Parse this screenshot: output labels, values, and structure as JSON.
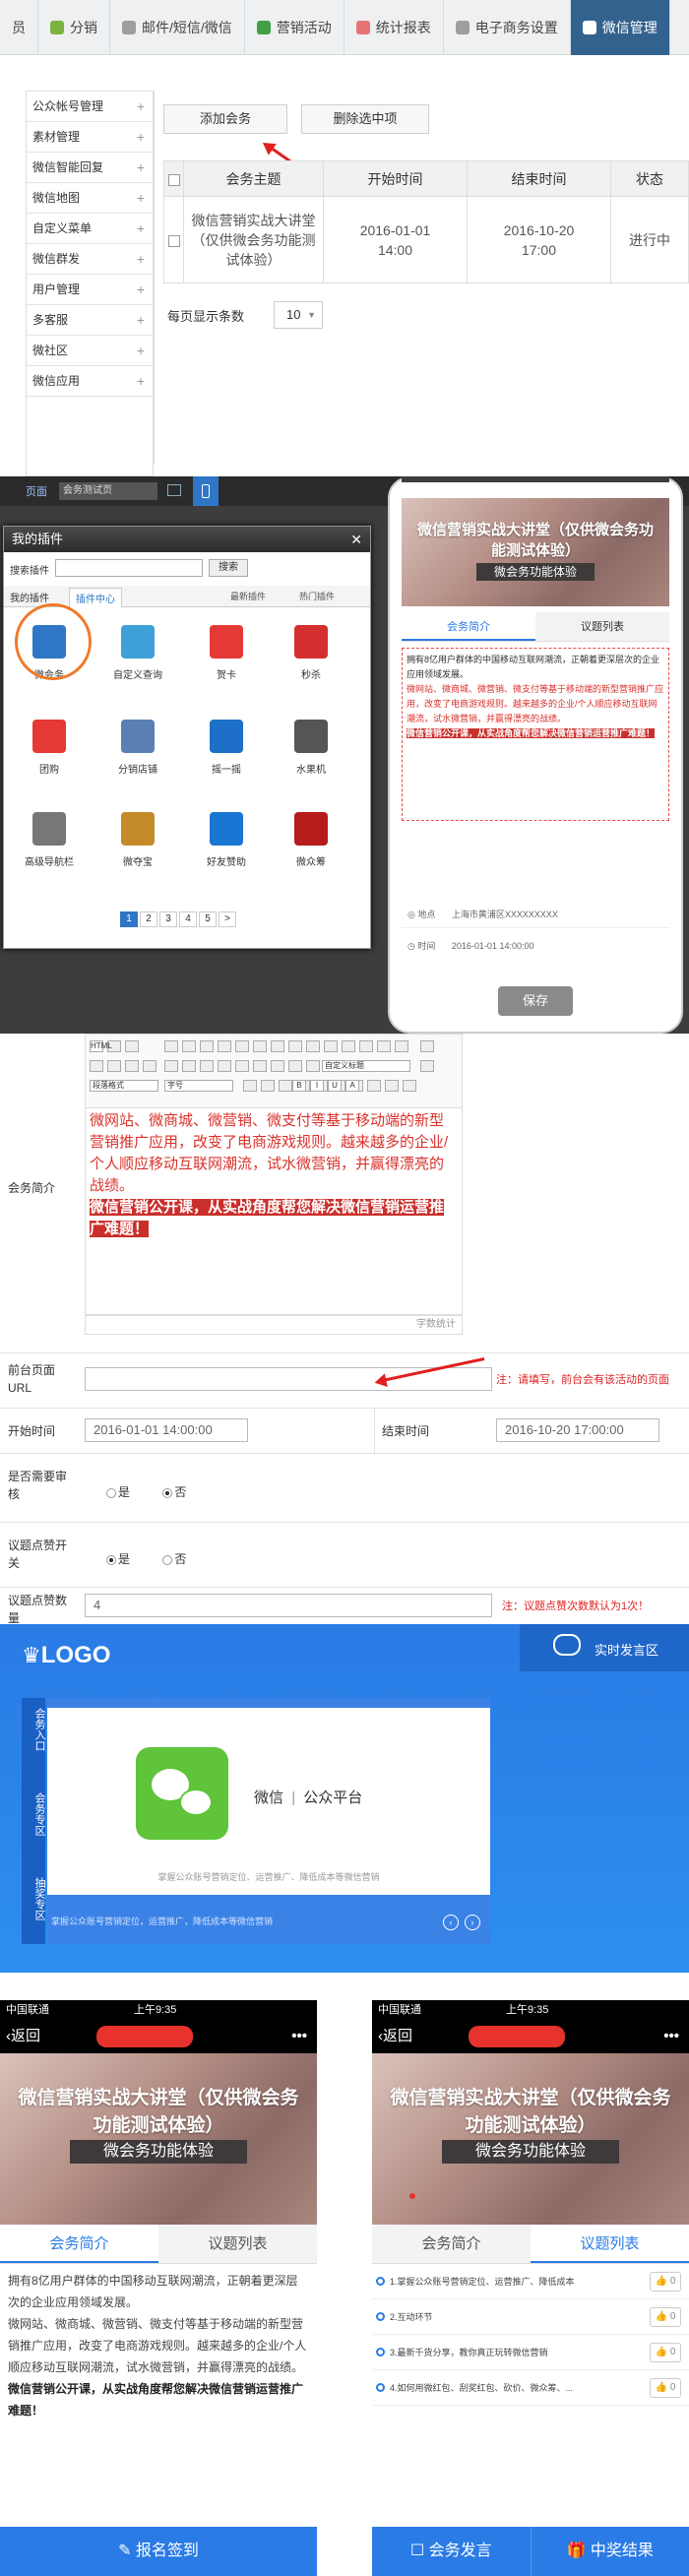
{
  "topnav": {
    "tabs": [
      {
        "label": "员",
        "icon": "",
        "color": "#8a8a8a"
      },
      {
        "label": "分销",
        "icon": "share-icon",
        "color": "#7cb342"
      },
      {
        "label": "邮件/短信/微信",
        "icon": "mail-icon",
        "color": "#9e9e9e"
      },
      {
        "label": "营销活动",
        "icon": "campaign-icon",
        "color": "#43a047"
      },
      {
        "label": "统计报表",
        "icon": "chart-icon",
        "color": "#e57373"
      },
      {
        "label": "电子商务设置",
        "icon": "shop-icon",
        "color": "#9e9e9e"
      },
      {
        "label": "微信管理",
        "icon": "wechat-icon",
        "color": "#ffffff"
      }
    ]
  },
  "sidemenu": {
    "items": [
      "公众帐号管理",
      "素材管理",
      "微信智能回复",
      "微信地图",
      "自定义菜单",
      "微信群发",
      "用户管理",
      "多客服",
      "微社区",
      "微信应用"
    ]
  },
  "toolbar": {
    "add": "添加会务",
    "delete": "删除选中项"
  },
  "table": {
    "headers": [
      "会务主题",
      "开始时间",
      "结束时间",
      "状态"
    ],
    "row": {
      "title": "微信营销实战大讲堂（仅供微会务功能测试体验）",
      "start": "2016-01-01 14:00",
      "end": "2016-10-20 17:00",
      "status": "进行中"
    }
  },
  "paging": {
    "label": "每页显示条数",
    "value": "10"
  },
  "editor": {
    "topbar": {
      "page": "页面",
      "select": "会务测试页"
    },
    "plugin": {
      "title": "我的插件",
      "search_label": "搜索插件",
      "search_btn": "搜索",
      "tab_mine": "我的插件",
      "tab_center": "插件中心",
      "newest": "最新插件",
      "hot": "热门插件",
      "items": [
        {
          "name": "微会务",
          "color": "#2f76c6"
        },
        {
          "name": "自定义查询",
          "color": "#3ea0d6"
        },
        {
          "name": "贺卡",
          "color": "#e53935"
        },
        {
          "name": "秒杀",
          "color": "#d32f2f"
        },
        {
          "name": "团购",
          "color": "#e53935"
        },
        {
          "name": "分销店铺",
          "color": "#5b7fb2"
        },
        {
          "name": "摇一摇",
          "color": "#1e6fc7"
        },
        {
          "name": "水果机",
          "color": "#555555"
        },
        {
          "name": "高级导航栏",
          "color": "#777777"
        },
        {
          "name": "微夺宝",
          "color": "#c58a2a"
        },
        {
          "name": "好友赞助",
          "color": "#1976d2"
        },
        {
          "name": "微众筹",
          "color": "#b71c1c"
        }
      ],
      "pages": [
        "1",
        "2",
        "3",
        "4",
        "5",
        ">"
      ]
    },
    "phone": {
      "hero_title": "微信营销实战大讲堂（仅供微会务功能测试体验）",
      "hero_sub": "微会务功能体验",
      "tab_intro": "会务简介",
      "tab_topics": "议题列表",
      "intro_black": "拥有8亿用户群体的中国移动互联网潮流，正朝着更深层次的企业应用领域发展。",
      "intro_red": "微网站、微商城、微营销、微支付等基于移动端的新型营销推广应用，改变了电商游戏规则。越来越多的企业/个人顺应移动互联网潮流，试水微营销，并赢得漂亮的战绩。",
      "intro_hl": "微信营销公开课，从实战角度帮您解决微信营销运营推广难题！",
      "loc_label": "地点",
      "loc_val": "上海市黄浦区XXXXXXXXX",
      "time_label": "时间",
      "time_val": "2016-01-01 14:00:00",
      "save": "保存"
    }
  },
  "form": {
    "intro_label": "会务简介",
    "toolbar_items": [
      "HTML",
      "B",
      "I",
      "U",
      "A",
      "x²",
      "x₂",
      "自定义标题",
      "段落格式",
      "字号"
    ],
    "intro_red": "微网站、微商城、微营销、微支付等基于移动端的新型营销推广应用，改变了电商游戏规则。越来越多的企业/个人顺应移动互联网潮流，试水微营销，并赢得漂亮的战绩。",
    "intro_hl": "微信营销公开课，从实战角度帮您解决微信营销运营推广难题！",
    "word_count": "字数统计",
    "url_label": "前台页面URL",
    "url_note": "注：请填写，前台会有该活动的页面",
    "start_label": "开始时间",
    "start_val": "2016-01-01 14:00:00",
    "end_label": "结束时间",
    "end_val": "2016-10-20 17:00:00",
    "review_label": "是否需要审核",
    "review_yes": "是",
    "review_no": "否",
    "like_label": "议题点赞开关",
    "like_yes": "是",
    "like_no": "否",
    "likecount_label": "议题点赞数量",
    "likecount_val": "4",
    "likecount_note": "注：议题点赞次数默认为1次！"
  },
  "s4": {
    "logo": "LOGO",
    "live": "实时发言区",
    "vtabs": [
      "会务入口",
      "会务专区",
      "抽奖专区"
    ],
    "brand": "微信",
    "brand_sub": "公众平台",
    "caption": "掌握公众账号营销定位、运营推广、降低成本等微信营销",
    "footer": "掌握公众账号营销定位，运营推广，降低成本等微信营销"
  },
  "mobile": {
    "carrier": "中国联通",
    "time": "上午9:35",
    "back": "返回",
    "hero_title": "微信营销实战大讲堂（仅供微会务功能测试体验）",
    "hero_sub": "微会务功能体验",
    "tab_intro": "会务简介",
    "tab_topics": "议题列表",
    "intro_black": "拥有8亿用户群体的中国移动互联网潮流，正朝着更深层次的企业应用领域发展。",
    "intro_black2": "微网站、微商城、微营销、微支付等基于移动端的新型营销推广应用，改变了电商游戏规则。越来越多的企业/个人顺应移动互联网潮流，试水微营销，并赢得漂亮的战绩。",
    "intro_bold": "微信营销公开课，从实战角度帮您解决微信营销运营推广难题！",
    "signup": "报名签到",
    "topics": [
      "1.掌握公众账号营销定位、运营推广、降低成本",
      "2.互动环节",
      "3.最新千货分享，教你真正玩转微信营销",
      "4.如何用微红包、刮奖红包、砍价、微众筹、..."
    ],
    "like": "0",
    "speak": "会务发言",
    "winners": "中奖结果"
  }
}
